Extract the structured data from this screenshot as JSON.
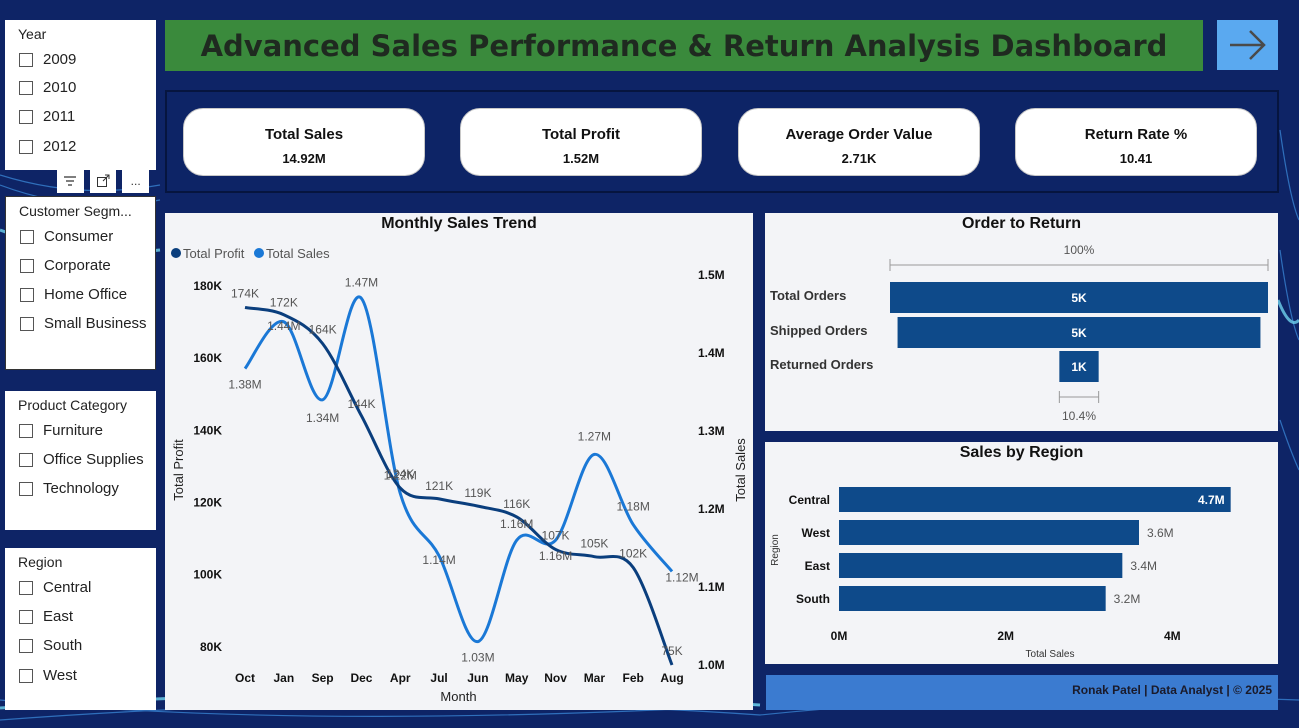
{
  "title": "Advanced Sales Performance & Return Analysis Dashboard",
  "slicers": {
    "year": {
      "title": "Year",
      "options": [
        "2009",
        "2010",
        "2011",
        "2012"
      ]
    },
    "segment": {
      "title": "Customer Segm...",
      "options": [
        "Consumer",
        "Corporate",
        "Home Office",
        "Small Business"
      ]
    },
    "category": {
      "title": "Product Category",
      "options": [
        "Furniture",
        "Office Supplies",
        "Technology"
      ]
    },
    "region": {
      "title": "Region",
      "options": [
        "Central",
        "East",
        "South",
        "West"
      ]
    }
  },
  "toolbar": {
    "filter_icon": "filter-icon",
    "focus_icon": "focus-mode-icon",
    "more_label": "..."
  },
  "kpis": [
    {
      "label": "Total Sales",
      "value": "14.92M"
    },
    {
      "label": "Total Profit",
      "value": "1.52M"
    },
    {
      "label": "Average Order Value",
      "value": "2.71K"
    },
    {
      "label": "Return Rate %",
      "value": "10.41"
    }
  ],
  "colors": {
    "profit": "#0a3e7d",
    "sales": "#1a78d6",
    "bar": "#0e4a8a",
    "title_green": "#3a8a3c",
    "arrow_blue": "#5aa9f0",
    "footer": "#3b7bd0"
  },
  "chart_data": [
    {
      "type": "line",
      "title": "Monthly Sales Trend",
      "xlabel": "Month",
      "ylabel": "Total Profit",
      "ylabel2": "Total Sales",
      "x": [
        "Oct",
        "Jan",
        "Sep",
        "Dec",
        "Apr",
        "Jul",
        "Jun",
        "May",
        "Nov",
        "Mar",
        "Feb",
        "Aug"
      ],
      "y_ticks": [
        "180K",
        "160K",
        "140K",
        "120K",
        "100K",
        "80K"
      ],
      "y2_ticks": [
        "1.5M",
        "1.4M",
        "1.3M",
        "1.2M",
        "1.1M",
        "1.0M"
      ],
      "ylim": [
        75000,
        183000
      ],
      "y2lim": [
        1000000,
        1500000
      ],
      "legend_position": "top-left",
      "series": [
        {
          "name": "Total Profit",
          "values": [
            174000,
            172000,
            164000,
            144000,
            124000,
            121000,
            119000,
            116000,
            107000,
            105000,
            102000,
            75000
          ],
          "labels": [
            "174K",
            "172K",
            "164K",
            "144K",
            "124K",
            "121K",
            "119K",
            "116K",
            "107K",
            "105K",
            "102K",
            "75K"
          ]
        },
        {
          "name": "Total Sales",
          "values": [
            1380000,
            1440000,
            1340000,
            1470000,
            1220000,
            1140000,
            1030000,
            1160000,
            1160000,
            1270000,
            1180000,
            1120000
          ],
          "labels": [
            "1.38M",
            "1.44M",
            "1.34M",
            "1.47M",
            "1.22M",
            "1.14M",
            "1.03M",
            "1.16M",
            "1.16M",
            "1.27M",
            "1.18M",
            "1.12M"
          ]
        }
      ]
    },
    {
      "type": "bar",
      "title": "Order to Return",
      "categories": [
        "Total Orders",
        "Shipped Orders",
        "Returned Orders"
      ],
      "values": [
        5000,
        4800,
        520
      ],
      "labels": [
        "5K",
        "5K",
        "1K"
      ],
      "top_pct": "100%",
      "bottom_pct": "10.4%"
    },
    {
      "type": "bar",
      "title": "Sales by Region",
      "xlabel": "Total Sales",
      "ylabel": "Region",
      "categories": [
        "Central",
        "West",
        "East",
        "South"
      ],
      "values": [
        4700000,
        3600000,
        3400000,
        3200000
      ],
      "labels": [
        "4.7M",
        "3.6M",
        "3.4M",
        "3.2M"
      ],
      "x_ticks": [
        "0M",
        "2M",
        "4M"
      ],
      "xlim": [
        0,
        4800000
      ]
    }
  ],
  "footer": "Ronak Patel | Data Analyst | © 2025"
}
